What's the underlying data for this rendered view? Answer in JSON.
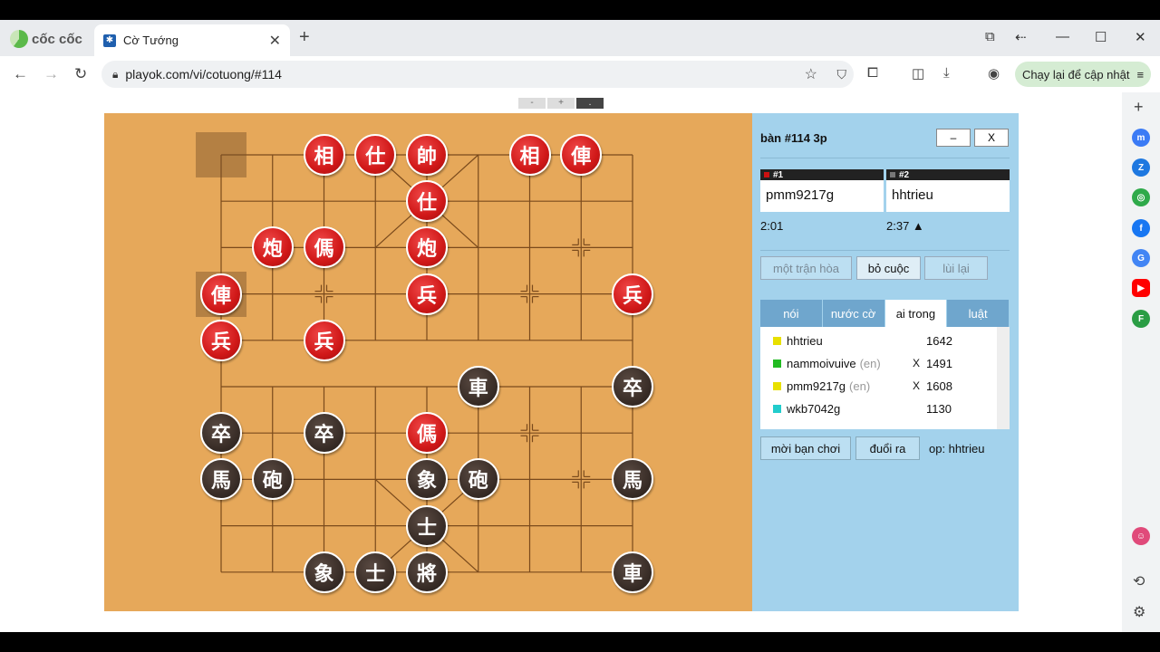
{
  "browser": {
    "logo_text": "cốc cốc",
    "tab_title": "Cờ Tướng",
    "url": "playok.com/vi/cotuong/#114",
    "update_label": "Chạy lại để cập nhật"
  },
  "zoom": {
    "minus": "-",
    "plus": "+",
    "dot": "."
  },
  "table": {
    "title": "bàn #114   3p",
    "min_label": "–",
    "close_label": "X",
    "player1": {
      "tag": "#1",
      "name": "pmm9217g",
      "clock": "2:01",
      "color": "#cc1111"
    },
    "player2": {
      "tag": "#2",
      "name": "hhtrieu",
      "clock": "2:37 ▲",
      "color": "#777777"
    },
    "actions": [
      {
        "label": "một trận hòa",
        "enabled": false
      },
      {
        "label": "bỏ cuộc",
        "enabled": true
      },
      {
        "label": "lùi lại",
        "enabled": false
      }
    ],
    "tabs": [
      "nói",
      "nước cờ",
      "ai trong",
      "luật"
    ],
    "active_tab": "ai trong",
    "users": [
      {
        "name": "hhtrieu",
        "en": "",
        "x": "",
        "rating": "1642",
        "color": "#e8e000"
      },
      {
        "name": "nammoivuive",
        "en": "(en)",
        "x": "X",
        "rating": "1491",
        "color": "#22bb22"
      },
      {
        "name": "pmm9217g",
        "en": "(en)",
        "x": "X",
        "rating": "1608",
        "color": "#e8e000"
      },
      {
        "name": "wkb7042g",
        "en": "",
        "x": "",
        "rating": "1130",
        "color": "#22cccc"
      }
    ],
    "invite_label": "mời bạn chơi",
    "kick_label": "đuổi ra",
    "op_label": "op: hhtrieu"
  },
  "board": {
    "pieces": [
      {
        "c": 2,
        "r": 0,
        "ch": "相",
        "side": "red"
      },
      {
        "c": 3,
        "r": 0,
        "ch": "仕",
        "side": "red"
      },
      {
        "c": 4,
        "r": 0,
        "ch": "帥",
        "side": "red"
      },
      {
        "c": 6,
        "r": 0,
        "ch": "相",
        "side": "red"
      },
      {
        "c": 7,
        "r": 0,
        "ch": "俥",
        "side": "red"
      },
      {
        "c": 4,
        "r": 1,
        "ch": "仕",
        "side": "red"
      },
      {
        "c": 1,
        "r": 2,
        "ch": "炮",
        "side": "red"
      },
      {
        "c": 2,
        "r": 2,
        "ch": "傌",
        "side": "red"
      },
      {
        "c": 4,
        "r": 2,
        "ch": "炮",
        "side": "red"
      },
      {
        "c": 0,
        "r": 3,
        "ch": "俥",
        "side": "red"
      },
      {
        "c": 4,
        "r": 3,
        "ch": "兵",
        "side": "red"
      },
      {
        "c": 8,
        "r": 3,
        "ch": "兵",
        "side": "red"
      },
      {
        "c": 0,
        "r": 4,
        "ch": "兵",
        "side": "red"
      },
      {
        "c": 2,
        "r": 4,
        "ch": "兵",
        "side": "red"
      },
      {
        "c": 5,
        "r": 5,
        "ch": "車",
        "side": "black"
      },
      {
        "c": 8,
        "r": 5,
        "ch": "卒",
        "side": "black"
      },
      {
        "c": 0,
        "r": 6,
        "ch": "卒",
        "side": "black"
      },
      {
        "c": 2,
        "r": 6,
        "ch": "卒",
        "side": "black"
      },
      {
        "c": 4,
        "r": 6,
        "ch": "傌",
        "side": "red"
      },
      {
        "c": 0,
        "r": 7,
        "ch": "馬",
        "side": "black"
      },
      {
        "c": 1,
        "r": 7,
        "ch": "砲",
        "side": "black"
      },
      {
        "c": 4,
        "r": 7,
        "ch": "象",
        "side": "black"
      },
      {
        "c": 5,
        "r": 7,
        "ch": "砲",
        "side": "black"
      },
      {
        "c": 8,
        "r": 7,
        "ch": "馬",
        "side": "black"
      },
      {
        "c": 4,
        "r": 8,
        "ch": "士",
        "side": "black"
      },
      {
        "c": 2,
        "r": 9,
        "ch": "象",
        "side": "black"
      },
      {
        "c": 3,
        "r": 9,
        "ch": "士",
        "side": "black"
      },
      {
        "c": 4,
        "r": 9,
        "ch": "將",
        "side": "black"
      },
      {
        "c": 8,
        "r": 9,
        "ch": "車",
        "side": "black"
      }
    ],
    "highlights": [
      {
        "c": 0,
        "r": 0
      },
      {
        "c": 0,
        "r": 3
      }
    ]
  }
}
